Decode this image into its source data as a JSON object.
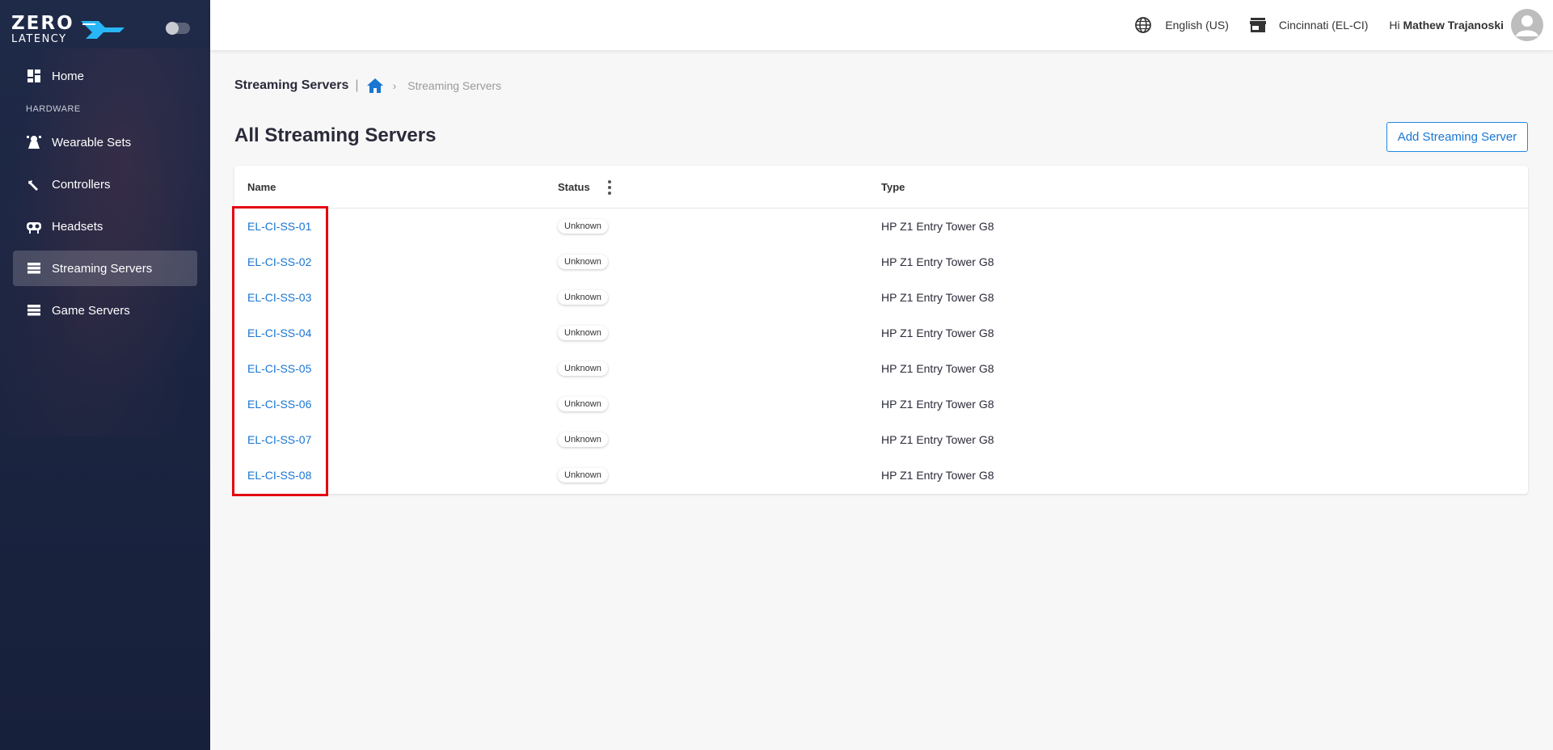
{
  "brand": {
    "line1": "ZERO",
    "line2": "LATENCY"
  },
  "sidebar": {
    "items": [
      {
        "label": "Home",
        "icon": "dashboard-icon"
      },
      {
        "label": "Wearable Sets",
        "icon": "wearable-icon"
      },
      {
        "label": "Controllers",
        "icon": "controller-icon"
      },
      {
        "label": "Headsets",
        "icon": "headset-icon"
      },
      {
        "label": "Streaming Servers",
        "icon": "server-icon",
        "active": true
      },
      {
        "label": "Game Servers",
        "icon": "server-icon"
      }
    ],
    "section_hardware": "HARDWARE"
  },
  "topbar": {
    "language": "English (US)",
    "location": "Cincinnati (EL-CI)",
    "greeting": "Hi",
    "user": "Mathew Trajanoski"
  },
  "breadcrumb": {
    "title": "Streaming Servers",
    "current": "Streaming Servers"
  },
  "page": {
    "title": "All Streaming Servers",
    "add_button": "Add Streaming Server"
  },
  "table": {
    "headers": {
      "name": "Name",
      "status": "Status",
      "type": "Type"
    },
    "rows": [
      {
        "name": "EL-CI-SS-01",
        "status": "Unknown",
        "type": "HP Z1 Entry Tower G8"
      },
      {
        "name": "EL-CI-SS-02",
        "status": "Unknown",
        "type": "HP Z1 Entry Tower G8"
      },
      {
        "name": "EL-CI-SS-03",
        "status": "Unknown",
        "type": "HP Z1 Entry Tower G8"
      },
      {
        "name": "EL-CI-SS-04",
        "status": "Unknown",
        "type": "HP Z1 Entry Tower G8"
      },
      {
        "name": "EL-CI-SS-05",
        "status": "Unknown",
        "type": "HP Z1 Entry Tower G8"
      },
      {
        "name": "EL-CI-SS-06",
        "status": "Unknown",
        "type": "HP Z1 Entry Tower G8"
      },
      {
        "name": "EL-CI-SS-07",
        "status": "Unknown",
        "type": "HP Z1 Entry Tower G8"
      },
      {
        "name": "EL-CI-SS-08",
        "status": "Unknown",
        "type": "HP Z1 Entry Tower G8"
      }
    ]
  },
  "colors": {
    "sidebar_bg": "#1f2a48",
    "accent": "#1976d2",
    "highlight": "#e4050f"
  }
}
